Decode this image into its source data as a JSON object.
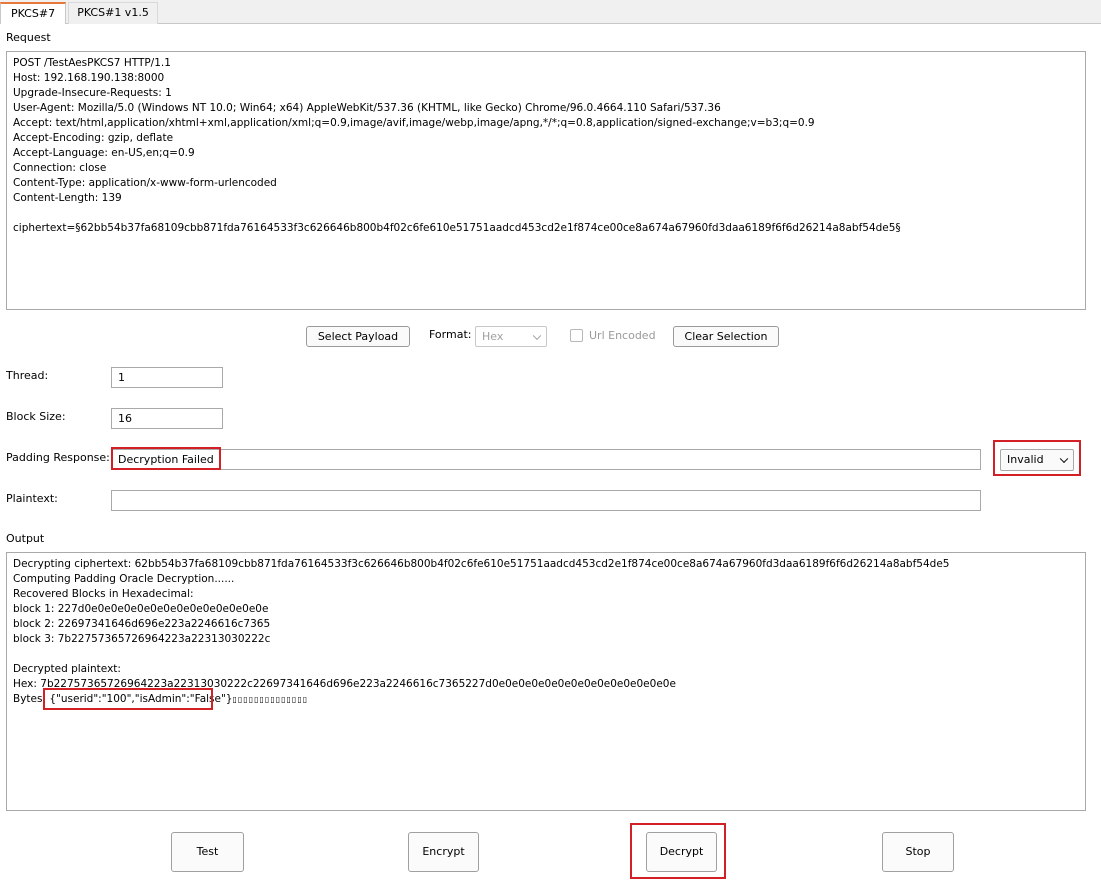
{
  "tabs": [
    {
      "label": "PKCS#7"
    },
    {
      "label": "PKCS#1 v1.5"
    }
  ],
  "request": {
    "label": "Request",
    "text": "POST /TestAesPKCS7 HTTP/1.1\nHost: 192.168.190.138:8000\nUpgrade-Insecure-Requests: 1\nUser-Agent: Mozilla/5.0 (Windows NT 10.0; Win64; x64) AppleWebKit/537.36 (KHTML, like Gecko) Chrome/96.0.4664.110 Safari/537.36\nAccept: text/html,application/xhtml+xml,application/xml;q=0.9,image/avif,image/webp,image/apng,*/*;q=0.8,application/signed-exchange;v=b3;q=0.9\nAccept-Encoding: gzip, deflate\nAccept-Language: en-US,en;q=0.9\nConnection: close\nContent-Type: application/x-www-form-urlencoded\nContent-Length: 139\n\nciphertext=§62bb54b37fa68109cbb871fda76164533f3c626646b800b4f02c6fe610e51751aadcd453cd2e1f874ce00ce8a674a67960fd3daa6189f6f6d26214a8abf54de5§"
  },
  "toolbar": {
    "select_payload": "Select Payload",
    "format_label": "Format:",
    "format_value": "Hex",
    "url_encoded": "Url Encoded",
    "clear_selection": "Clear Selection"
  },
  "thread": {
    "label": "Thread:",
    "value": "1"
  },
  "block_size": {
    "label": "Block Size:",
    "value": "16"
  },
  "padding_response": {
    "label": "Padding Response:",
    "value": "Decryption Failed",
    "mode": "Invalid"
  },
  "plaintext": {
    "label": "Plaintext:",
    "value": ""
  },
  "output": {
    "label": "Output",
    "line1": "Decrypting ciphertext: 62bb54b37fa68109cbb871fda76164533f3c626646b800b4f02c6fe610e51751aadcd453cd2e1f874ce00ce8a674a67960fd3daa6189f6f6d26214a8abf54de5",
    "line2": "Computing Padding Oracle Decryption......",
    "line3": "Recovered Blocks in Hexadecimal:",
    "line4": "block 1: 227d0e0e0e0e0e0e0e0e0e0e0e0e0e0e",
    "line5": "block 2: 22697341646d696e223a2246616c7365",
    "line6": "block 3: 7b22757365726964223a22313030222c",
    "line7": "Decrypted plaintext:",
    "line8": "Hex: 7b22757365726964223a22313030222c22697341646d696e223a2246616c7365227d0e0e0e0e0e0e0e0e0e0e0e0e0e0e",
    "bytes_prefix": "Bytes: ",
    "bytes_json": "{\"userid\":\"100\",\"isAdmin\":\"False\"}",
    "bytes_tail": "▯▯▯▯▯▯▯▯▯▯▯▯▯▯"
  },
  "actions": {
    "test": "Test",
    "encrypt": "Encrypt",
    "decrypt": "Decrypt",
    "stop": "Stop"
  },
  "colors": {
    "highlight": "#d32027",
    "tab_accent": "#e8773a"
  }
}
